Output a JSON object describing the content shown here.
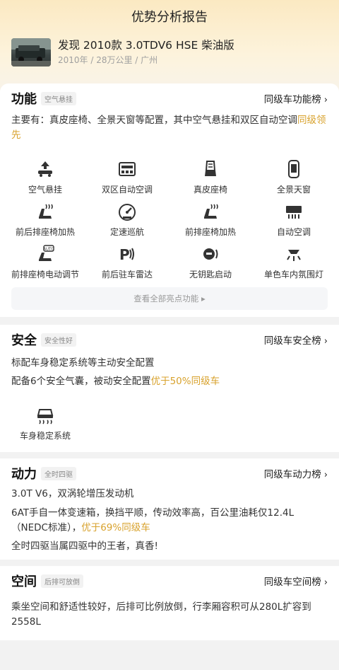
{
  "header": {
    "title": "优势分析报告",
    "car_title": "发现 2010款 3.0TDV6 HSE 柴油版",
    "car_meta": "2010年 / 28万公里 / 广州"
  },
  "function": {
    "title": "功能",
    "tag": "空气悬挂",
    "rank_link": "同级车功能榜",
    "desc_prefix": "主要有：真皮座椅、全景天窗等配置，其中空气悬挂和双区自动空调",
    "desc_highlight": "同级领先",
    "features": [
      {
        "label": "空气悬挂",
        "icon": "air-suspension-icon"
      },
      {
        "label": "双区自动空调",
        "icon": "dual-zone-ac-icon"
      },
      {
        "label": "真皮座椅",
        "icon": "leather-seat-icon"
      },
      {
        "label": "全景天窗",
        "icon": "panoramic-sunroof-icon"
      },
      {
        "label": "前后排座椅加热",
        "icon": "seat-heating-icon"
      },
      {
        "label": "定速巡航",
        "icon": "cruise-control-icon"
      },
      {
        "label": "前排座椅加热",
        "icon": "front-seat-heating-icon"
      },
      {
        "label": "自动空调",
        "icon": "auto-ac-icon"
      },
      {
        "label": "前排座椅电动调节",
        "icon": "power-seat-icon"
      },
      {
        "label": "前后驻车雷达",
        "icon": "parking-radar-icon"
      },
      {
        "label": "无钥匙启动",
        "icon": "keyless-start-icon"
      },
      {
        "label": "单色车内氛围灯",
        "icon": "ambient-light-icon"
      }
    ],
    "view_all": "查看全部亮点功能"
  },
  "safety": {
    "title": "安全",
    "tag": "安全性好",
    "rank_link": "同级车安全榜",
    "line1": "标配车身稳定系统等主动安全配置",
    "line2_prefix": "配备6个安全气囊，被动安全配置",
    "line2_highlight": "优于50%同级车",
    "feature_label": "车身稳定系统",
    "feature_icon": "stability-control-icon"
  },
  "power": {
    "title": "动力",
    "tag": "全时四驱",
    "rank_link": "同级车动力榜",
    "line1": "3.0T V6，双涡轮增压发动机",
    "line2_prefix": "6AT手自一体变速箱，换挡平顺，传动效率高，百公里油耗仅12.4L（NEDC标准），",
    "line2_highlight": "优于69%同级车",
    "line3": "全时四驱当属四驱中的王者，真香!"
  },
  "space": {
    "title": "空间",
    "tag": "后排可放倒",
    "rank_link": "同级车空间榜",
    "line1": "乘坐空间和舒适性较好，后排可比例放倒，行李厢容积可从280L扩容到2558L"
  },
  "colors": {
    "highlight": "#d8a22d",
    "header_gradient_top": "#fbe9c2"
  }
}
